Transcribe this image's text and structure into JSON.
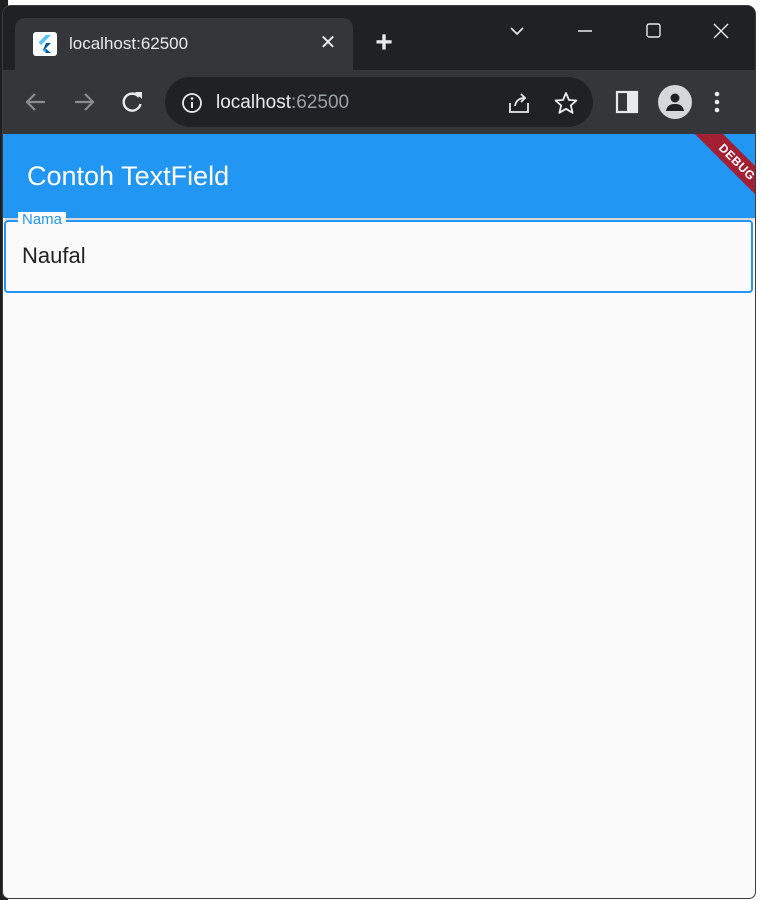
{
  "browser": {
    "tab": {
      "title": "localhost:62500",
      "close_glyph": "✕"
    },
    "new_tab_glyph": "+",
    "url": {
      "host": "localhost",
      "port": ":62500"
    }
  },
  "app": {
    "title": "Contoh TextField",
    "debug_banner": "DEBUG",
    "accent_color": "#2196f3",
    "text_field": {
      "label": "Nama",
      "value": "Naufal"
    }
  },
  "icons": {
    "favicon": "flutter-icon",
    "back": "arrow-left-icon",
    "forward": "arrow-right-icon",
    "reload": "reload-icon",
    "info": "info-icon",
    "share": "share-icon",
    "bookmark": "star-icon",
    "side_panel": "side-panel-icon",
    "profile": "profile-icon",
    "menu": "kebab-menu-icon"
  }
}
